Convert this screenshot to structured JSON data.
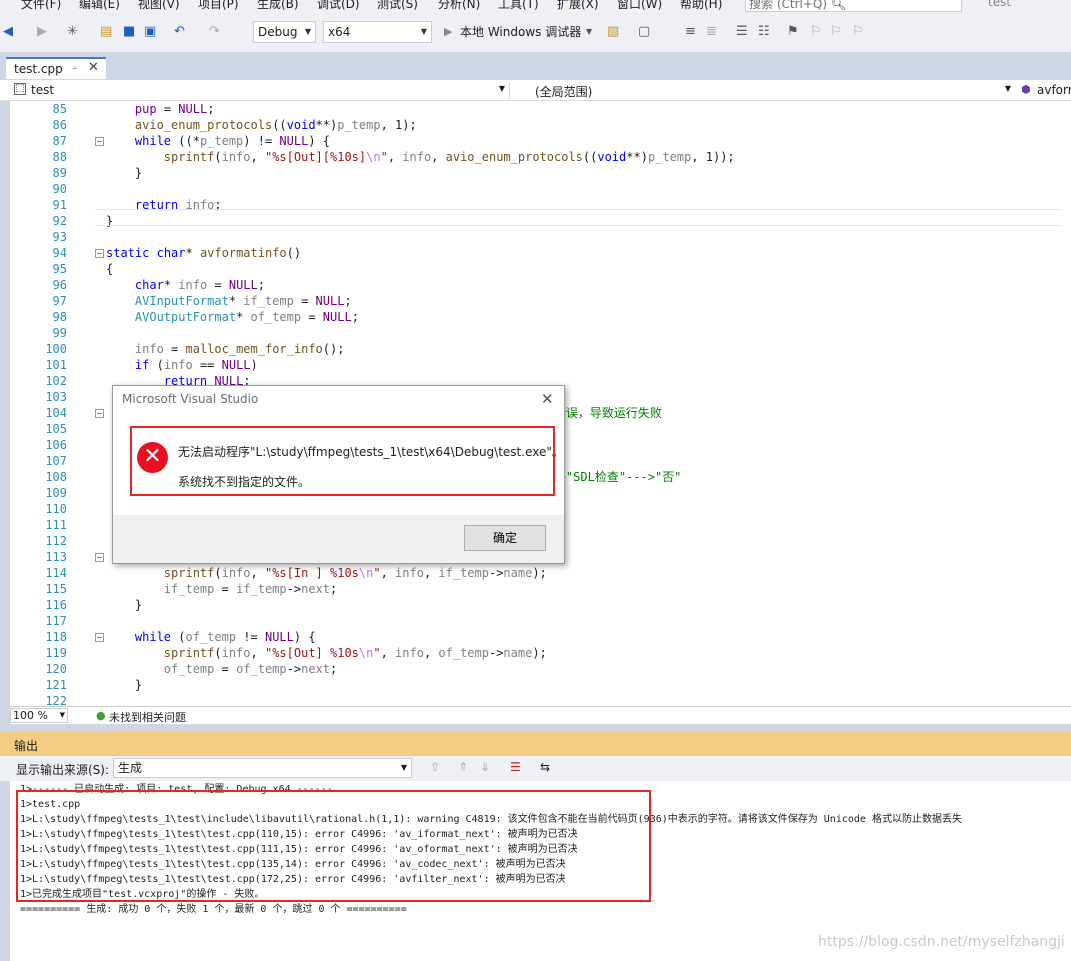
{
  "menu": {
    "items": [
      "文件(F)",
      "编辑(E)",
      "视图(V)",
      "项目(P)",
      "生成(B)",
      "调试(D)",
      "测试(S)",
      "分析(N)",
      "工具(T)",
      "扩展(X)",
      "窗口(W)",
      "帮助(H)"
    ],
    "search_placeholder": "搜索 (Ctrl+Q)",
    "solution_name": "test"
  },
  "toolbar": {
    "config": "Debug",
    "platform": "x64",
    "run_label": "本地 Windows 调试器"
  },
  "tab": {
    "file": "test.cpp"
  },
  "navbar": {
    "project": "test",
    "scope": "(全局范围)",
    "member": "avforr"
  },
  "code_lines": [
    {
      "n": "85",
      "html": "    <span class=\"mac\">pup</span> = <span class=\"mac\">NULL</span>;"
    },
    {
      "n": "86",
      "html": "    <span class=\"fn\">avio_enum_protocols</span>((<span class=\"kw\">void</span>**)<span class=\"par\">p_temp</span>, 1);"
    },
    {
      "n": "87",
      "html": "    <span class=\"kw\">while</span> ((*<span class=\"par\">p_temp</span>) != <span class=\"mac\">NULL</span>) {"
    },
    {
      "n": "88",
      "html": "        <span class=\"fn\">sprintf</span>(<span class=\"par\">info</span>, <span class=\"str\">\"%s[Out][%10s]<span class=\"esc\">\\n</span>\"</span>, <span class=\"par\">info</span>, <span class=\"fn\">avio_enum_protocols</span>((<span class=\"kw\">void</span>**)<span class=\"par\">p_temp</span>, 1));"
    },
    {
      "n": "89",
      "html": "    }"
    },
    {
      "n": "90",
      "html": ""
    },
    {
      "n": "91",
      "html": "    <span class=\"kw\">return</span> <span class=\"par\">info</span>;"
    },
    {
      "n": "92",
      "html": "}"
    },
    {
      "n": "93",
      "html": ""
    },
    {
      "n": "94",
      "html": "<span class=\"kw\">static</span> <span class=\"kw\">char</span>* <span class=\"fn\">avformatinfo</span>()"
    },
    {
      "n": "95",
      "html": "{"
    },
    {
      "n": "96",
      "html": "    <span class=\"kw\">char</span>* <span class=\"par\">info</span> = <span class=\"mac\">NULL</span>;"
    },
    {
      "n": "97",
      "html": "    <span class=\"ty\">AVInputFormat</span>* <span class=\"par\">if_temp</span> = <span class=\"mac\">NULL</span>;"
    },
    {
      "n": "98",
      "html": "    <span class=\"ty\">AVOutputFormat</span>* <span class=\"par\">of_temp</span> = <span class=\"mac\">NULL</span>;"
    },
    {
      "n": "99",
      "html": ""
    },
    {
      "n": "100",
      "html": "    <span class=\"par\">info</span> = <span class=\"fn\">malloc_mem_for_info</span>();"
    },
    {
      "n": "101",
      "html": "    <span class=\"kw\">if</span> (<span class=\"par\">info</span> == <span class=\"mac\">NULL</span>)"
    },
    {
      "n": "102",
      "html": "        <span class=\"kw\">return</span> <span class=\"mac\">NULL</span>;"
    },
    {
      "n": "103",
      "html": ""
    },
    {
      "n": "104",
      "html": "                                                         <span class=\"cm\">否决的错误，导致运行失败</span>"
    },
    {
      "n": "105",
      "html": ""
    },
    {
      "n": "106",
      "html": ""
    },
    {
      "n": "107",
      "html": ""
    },
    {
      "n": "108",
      "html": "                                                         <span class=\"cm\">规\"--->\"SDL检查\"--->\"否\"</span>"
    },
    {
      "n": "109",
      "html": ""
    },
    {
      "n": "110",
      "html": ""
    },
    {
      "n": "111",
      "html": ""
    },
    {
      "n": "112",
      "html": ""
    },
    {
      "n": "113",
      "html": ""
    },
    {
      "n": "114",
      "html": "        <span class=\"fn\">sprintf</span>(<span class=\"par\">info</span>, <span class=\"str\">\"%s[In ] %10s<span class=\"esc\">\\n</span>\"</span>, <span class=\"par\">info</span>, <span class=\"par\">if_temp</span>-><span class=\"par\">name</span>);"
    },
    {
      "n": "115",
      "html": "        <span class=\"par\">if_temp</span> = <span class=\"par\">if_temp</span>-><span class=\"par\">next</span>;"
    },
    {
      "n": "116",
      "html": "    }"
    },
    {
      "n": "117",
      "html": ""
    },
    {
      "n": "118",
      "html": "    <span class=\"kw\">while</span> (<span class=\"par\">of_temp</span> != <span class=\"mac\">NULL</span>) {"
    },
    {
      "n": "119",
      "html": "        <span class=\"fn\">sprintf</span>(<span class=\"par\">info</span>, <span class=\"str\">\"%s[Out] %10s<span class=\"esc\">\\n</span>\"</span>, <span class=\"par\">info</span>, <span class=\"par\">of_temp</span>-><span class=\"par\">name</span>);"
    },
    {
      "n": "120",
      "html": "        <span class=\"par\">of_temp</span> = <span class=\"par\">of_temp</span>-><span class=\"par\">next</span>;"
    },
    {
      "n": "121",
      "html": "    }"
    },
    {
      "n": "122",
      "html": ""
    }
  ],
  "editor_status": {
    "zoom": "100 %",
    "issues": "未找到相关问题"
  },
  "output": {
    "title": "输出",
    "source_label": "显示输出来源(S):",
    "source_value": "生成",
    "lines": [
      "1>------ 已启动生成: 项目: test, 配置: Debug x64 ------",
      "1>test.cpp",
      "1>L:\\study\\ffmpeg\\tests_1\\test\\include\\libavutil\\rational.h(1,1): warning C4819: 该文件包含不能在当前代码页(936)中表示的字符。请将该文件保存为 Unicode 格式以防止数据丢失",
      "1>L:\\study\\ffmpeg\\tests_1\\test\\test.cpp(110,15): error C4996: 'av_iformat_next': 被声明为已否决",
      "1>L:\\study\\ffmpeg\\tests_1\\test\\test.cpp(111,15): error C4996: 'av_oformat_next': 被声明为已否决",
      "1>L:\\study\\ffmpeg\\tests_1\\test\\test.cpp(135,14): error C4996: 'av_codec_next': 被声明为已否决",
      "1>L:\\study\\ffmpeg\\tests_1\\test\\test.cpp(172,25): error C4996: 'avfilter_next': 被声明为已否决",
      "1>已完成生成项目\"test.vcxproj\"的操作 - 失败。",
      "========== 生成: 成功 0 个，失败 1 个，最新 0 个，跳过 0 个 =========="
    ]
  },
  "dialog": {
    "title": "Microsoft Visual Studio",
    "message": "无法启动程序\"L:\\study\\ffmpeg\\tests_1\\test\\x64\\Debug\\test.exe\"。",
    "detail": "系统找不到指定的文件。",
    "ok_label": "确定"
  },
  "watermark": "https://blog.csdn.net/myselfzhangji",
  "colors": {
    "accent": "#4d74c7",
    "error": "#e81123",
    "highlight_box": "#e32626",
    "output_header": "#f5cc84"
  }
}
